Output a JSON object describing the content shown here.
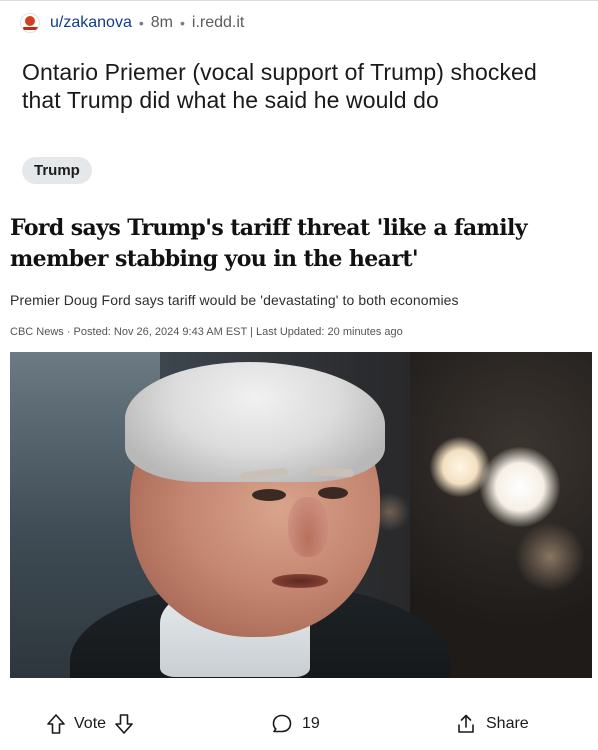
{
  "post": {
    "username": "u/zakanova",
    "age": "8m",
    "domain": "i.redd.it",
    "title": "Ontario Priemer (vocal support of Trump) shocked that Trump did what he said he would do",
    "flair": "Trump"
  },
  "article": {
    "headline": "Ford says Trump's tariff threat 'like a family member stabbing you in the heart'",
    "subheadline": "Premier Doug Ford says tariff would be 'devastating' to both economies",
    "byline": "CBC News · Posted: Nov 26, 2024 9:43 AM EST | Last Updated: 20 minutes ago"
  },
  "actions": {
    "vote_label": "Vote",
    "comments_count": "19",
    "share_label": "Share"
  },
  "icons": {
    "avatar": "subreddit-avatar-icon",
    "upvote": "upvote-arrow-icon",
    "downvote": "downvote-arrow-icon",
    "comment": "comment-bubble-icon",
    "share": "share-icon"
  },
  "colors": {
    "username": "#0f3d8c",
    "flair_bg": "#e5e8ea",
    "text": "#1a1a1b"
  }
}
